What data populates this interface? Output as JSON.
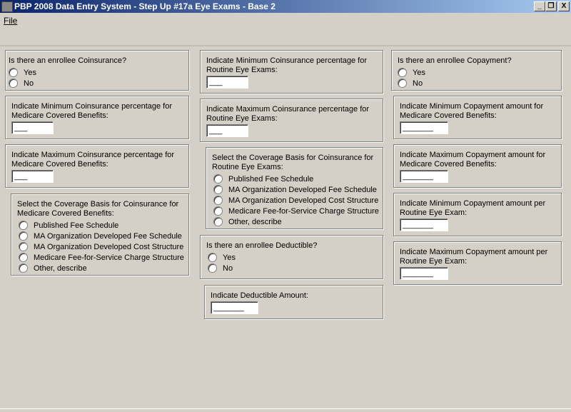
{
  "window": {
    "title": "PBP 2008 Data Entry System - Step Up #17a Eye Exams - Base 2",
    "min": "_",
    "restore": "❐",
    "close": "X"
  },
  "menu": {
    "file": "File"
  },
  "yes": "Yes",
  "no": "No",
  "col1": {
    "coins_q": "Is there an enrollee Coinsurance?",
    "min_label": "Indicate Minimum Coinsurance percentage for Medicare Covered Benefits:",
    "min_value": "___",
    "max_label": "Indicate Maximum Coinsurance percentage for Medicare Covered Benefits:",
    "max_value": "___",
    "basis_label": "Select the Coverage Basis for Coinsurance for Medicare Covered Benefits:",
    "basis_options": [
      "Published Fee Schedule",
      "MA Organization Developed Fee Schedule",
      "MA Organization Developed Cost Structure",
      "Medicare Fee-for-Service Charge Structure",
      "Other, describe"
    ]
  },
  "col2": {
    "min_label": "Indicate Minimum Coinsurance percentage for Routine Eye Exams:",
    "min_value": "___",
    "max_label": "Indicate Maximum Coinsurance percentage for Routine Eye Exams:",
    "max_value": "___",
    "basis_label": "Select the Coverage Basis for Coinsurance for Routine Eye Exams:",
    "basis_options": [
      "Published Fee Schedule",
      "MA Organization Developed Fee Schedule",
      "MA Organization Developed Cost Structure",
      "Medicare Fee-for-Service Charge Structure",
      "Other, describe"
    ],
    "ded_q": "Is there an enrollee Deductible?",
    "ded_label": "Indicate Deductible Amount:",
    "ded_value": "_______"
  },
  "col3": {
    "copay_q": "Is there an enrollee Copayment?",
    "min_label": "Indicate Minimum Copayment amount for Medicare Covered Benefits:",
    "min_value": "_______",
    "max_label": "Indicate Maximum Copayment amount for Medicare Covered Benefits:",
    "max_value": "_______",
    "min_eye_label": "Indicate Minimum Copayment amount per Routine Eye Exam:",
    "min_eye_value": "_______",
    "max_eye_label": "Indicate Maximum Copayment amount per Routine Eye Exam:",
    "max_eye_value": "_______"
  }
}
